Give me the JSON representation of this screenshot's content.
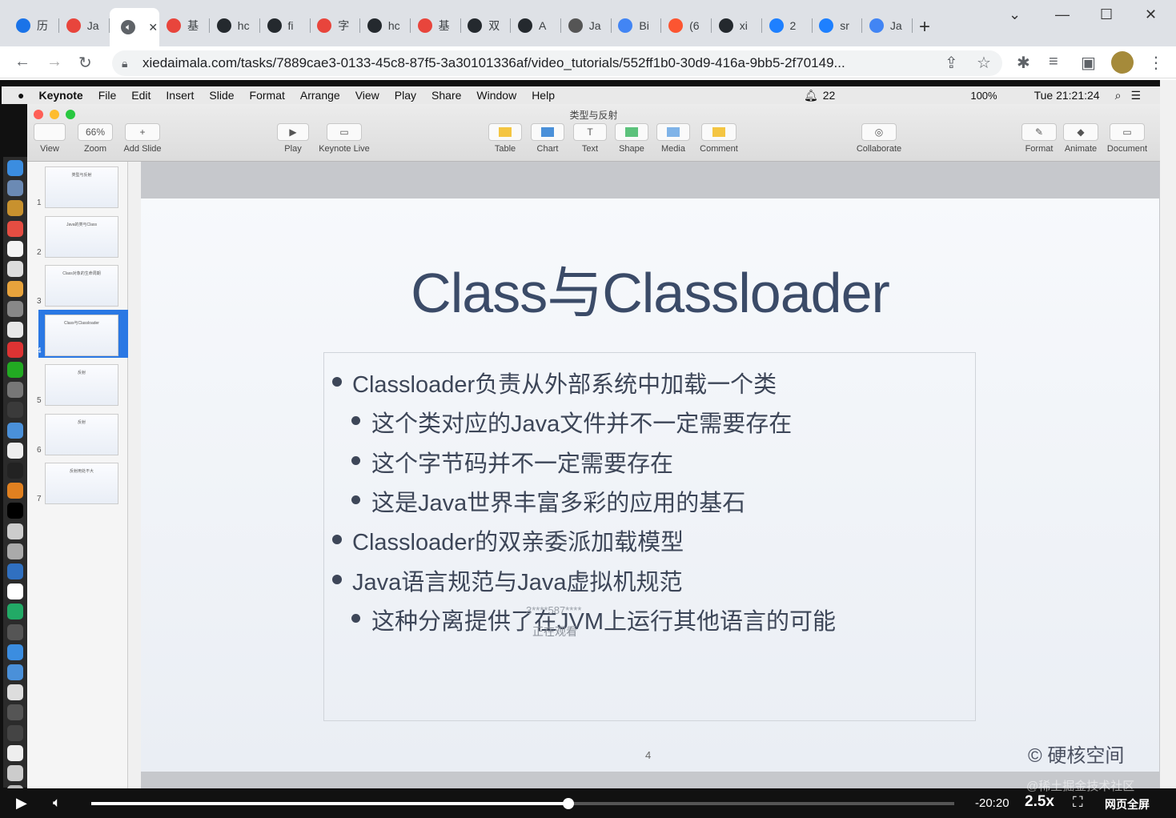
{
  "browser": {
    "tabs": [
      {
        "label": "历",
        "icon": "history-icon",
        "color": "#1a73e8"
      },
      {
        "label": "Ja",
        "icon": "xml-icon",
        "color": "#e8453c"
      },
      {
        "label": "",
        "icon": "audio-icon",
        "color": "#5f6368",
        "active": true
      },
      {
        "label": "基",
        "icon": "xml-icon",
        "color": "#e8453c"
      },
      {
        "label": "hc",
        "icon": "github-icon",
        "color": "#24292e"
      },
      {
        "label": "fi",
        "icon": "github-icon",
        "color": "#24292e"
      },
      {
        "label": "字",
        "icon": "xml-icon",
        "color": "#e8453c"
      },
      {
        "label": "hc",
        "icon": "github-icon",
        "color": "#24292e"
      },
      {
        "label": "基",
        "icon": "xml-icon",
        "color": "#e8453c"
      },
      {
        "label": "双",
        "icon": "github-icon",
        "color": "#24292e"
      },
      {
        "label": "A",
        "icon": "github-icon",
        "color": "#24292e"
      },
      {
        "label": "Ja",
        "icon": "tool-icon",
        "color": "#555"
      },
      {
        "label": "Bi",
        "icon": "google-icon",
        "color": "#4285f4"
      },
      {
        "label": "(6",
        "icon": "csdn-icon",
        "color": "#fc5531"
      },
      {
        "label": "xi",
        "icon": "github-icon",
        "color": "#24292e"
      },
      {
        "label": "2",
        "icon": "juejin-icon",
        "color": "#1e80ff"
      },
      {
        "label": "sr",
        "icon": "juejin-icon",
        "color": "#1e80ff"
      },
      {
        "label": "Ja",
        "icon": "google-icon",
        "color": "#4285f4"
      }
    ],
    "new_tab": "+",
    "url": "xiedaimala.com/tasks/7889cae3-0133-45c8-87f5-3a30101336af/video_tutorials/552ff1b0-30d9-416a-9bb5-2f70149..."
  },
  "mac_menu": [
    "Keynote",
    "File",
    "Edit",
    "Insert",
    "Slide",
    "Format",
    "Arrange",
    "View",
    "Play",
    "Share",
    "Window",
    "Help"
  ],
  "mac_status": {
    "notif": "22",
    "battery": "100%",
    "clock": "Tue 21:21:24"
  },
  "keynote": {
    "doc_title": "类型与反射",
    "toolbar_left": [
      {
        "label": "View",
        "icon": "view-icon"
      },
      {
        "label": "Zoom",
        "value": "66%"
      },
      {
        "label": "Add Slide",
        "icon": "plus-icon"
      }
    ],
    "toolbar_mid1": [
      {
        "label": "Play"
      },
      {
        "label": "Keynote Live"
      }
    ],
    "toolbar_mid2": [
      {
        "label": "Table"
      },
      {
        "label": "Chart"
      },
      {
        "label": "Text"
      },
      {
        "label": "Shape"
      },
      {
        "label": "Media"
      },
      {
        "label": "Comment"
      }
    ],
    "collaborate": "Collaborate",
    "toolbar_right": [
      {
        "label": "Format"
      },
      {
        "label": "Animate"
      },
      {
        "label": "Document"
      }
    ],
    "slide_numbers": [
      "1",
      "2",
      "3",
      "4",
      "5",
      "6",
      "7"
    ],
    "thumb_titles": [
      "类型与反射",
      "Java的类与Class",
      "Class对象的生命周期",
      "Class与Classloader",
      "反射",
      "反射",
      "反射用处不大"
    ],
    "selected_slide": 4
  },
  "slide": {
    "title": "Class与Classloader",
    "bullets": [
      {
        "level": 1,
        "text": "Classloader负责从外部系统中加载一个类"
      },
      {
        "level": 2,
        "text": "这个类对应的Java文件并不一定需要存在"
      },
      {
        "level": 2,
        "text": "这个字节码并不一定需要存在"
      },
      {
        "level": 2,
        "text": "这是Java世界丰富多彩的应用的基石"
      },
      {
        "level": 1,
        "text": "Classloader的双亲委派加载模型"
      },
      {
        "level": 1,
        "text": "Java语言规范与Java虚拟机规范"
      },
      {
        "level": 2,
        "text": "这种分离提供了在JVM上运行其他语言的可能"
      }
    ],
    "page_number": "4",
    "copyright": "© 硬核空间",
    "overlay_id": "3****587****",
    "overlay_status": "正在观看"
  },
  "player": {
    "time_remaining": "-20:20",
    "speed": "2.5x",
    "fullpage": "网页全屏",
    "watermark": "@稀土掘金技术社区",
    "progress": 0.65
  }
}
